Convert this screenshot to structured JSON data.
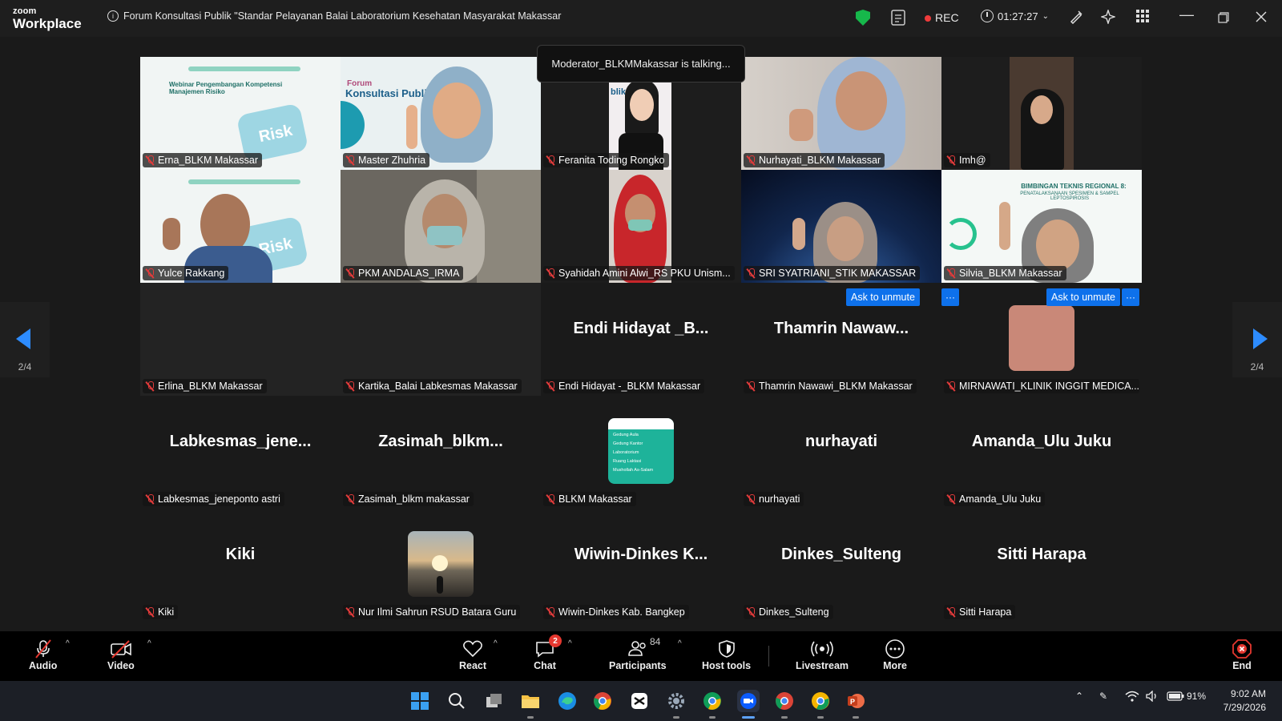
{
  "titlebar": {
    "logo_small": "zoom",
    "logo_big": "Workplace",
    "meeting_title": "Forum Konsultasi Publik \"Standar Pelayanan Balai Laboratorium Kesehatan Masyarakat Makassar",
    "rec_label": "REC",
    "timer": "01:27:27",
    "shield_color": "#16b84b",
    "rec_color": "#ef3b3b"
  },
  "talking_notice": "Moderator_BLKMMakassar is talking...",
  "tiles": [
    {
      "name": "Erna_BLKM Makassar"
    },
    {
      "name": "Master Zhuhria"
    },
    {
      "name": "Feranita Toding Rongko"
    },
    {
      "name": "Nurhayati_BLKM Makassar"
    },
    {
      "name": "Imh@"
    },
    {
      "name": "Yulce Rakkang"
    },
    {
      "name": "PKM ANDALAS_IRMA"
    },
    {
      "name": "Syahidah Amini Alwi_RS PKU Unism..."
    },
    {
      "name": "SRI SYATRIANI_STIK MAKASSAR"
    },
    {
      "name": "Silvia_BLKM Makassar"
    },
    {
      "name": "Erlina_BLKM Makassar"
    },
    {
      "name": "Kartika_Balai Labkesmas Makassar"
    },
    {
      "name": "Endi Hidayat -_BLKM Makassar",
      "display": "Endi  Hidayat _B..."
    },
    {
      "name": "Thamrin Nawawi_BLKM Makassar",
      "display": "Thamrin  Nawaw..."
    },
    {
      "name": "MIRNAWATI_KLINIK INGGIT MEDICA..."
    },
    {
      "name": "Labkesmas_jeneponto astri",
      "display": "Labkesmas_jene..."
    },
    {
      "name": "Zasimah_blkm makassar",
      "display": "Zasimah_blkm..."
    },
    {
      "name": "BLKM Makassar"
    },
    {
      "name": "nurhayati",
      "display": "nurhayati"
    },
    {
      "name": "Amanda_Ulu Juku",
      "display": "Amanda_Ulu Juku"
    },
    {
      "name": "Kiki",
      "display": "Kiki"
    },
    {
      "name": "Nur Ilmi Sahrun RSUD Batara Guru"
    },
    {
      "name": "Wiwin-Dinkes Kab. Bangkep",
      "display": "Wiwin-Dinkes  K..."
    },
    {
      "name": "Dinkes_Sulteng",
      "display": "Dinkes_Sulteng"
    },
    {
      "name": "Sitti Harapa",
      "display": "Sitti Harapa"
    }
  ],
  "tile_text": {
    "webinar_1": "Webinar Pengembangan Kompetensi Manajemen Risiko",
    "risk": "Risk",
    "forum": "Forum",
    "konsultasi": "Konsultasi Publik",
    "blik": "blik",
    "bimtek_title": "BIMBINGAN TEKNIS REGIONAL 8:",
    "bimtek_sub": "PENATALAKSANAAN SPESIMEN & SAMPEL LEPTOSPIROSIS",
    "blkm_menu": [
      "Gedung Aula",
      "Gedung Kantor",
      "Laboratorium",
      "Ruang Laktasi",
      "Mushollah As-Salam"
    ]
  },
  "ask_to_unmute": "Ask to unmute",
  "more_dots": "···",
  "pager": {
    "left": "2/4",
    "right": "2/4"
  },
  "toolbar": {
    "audio": "Audio",
    "video": "Video",
    "react": "React",
    "chat": "Chat",
    "chat_badge": "2",
    "participants": "Participants",
    "participants_count": "84",
    "host_tools": "Host tools",
    "livestream": "Livestream",
    "more": "More",
    "end": "End"
  },
  "taskbar": {
    "battery": "91%",
    "time": "9:02 AM",
    "date": "7/29/2026"
  }
}
